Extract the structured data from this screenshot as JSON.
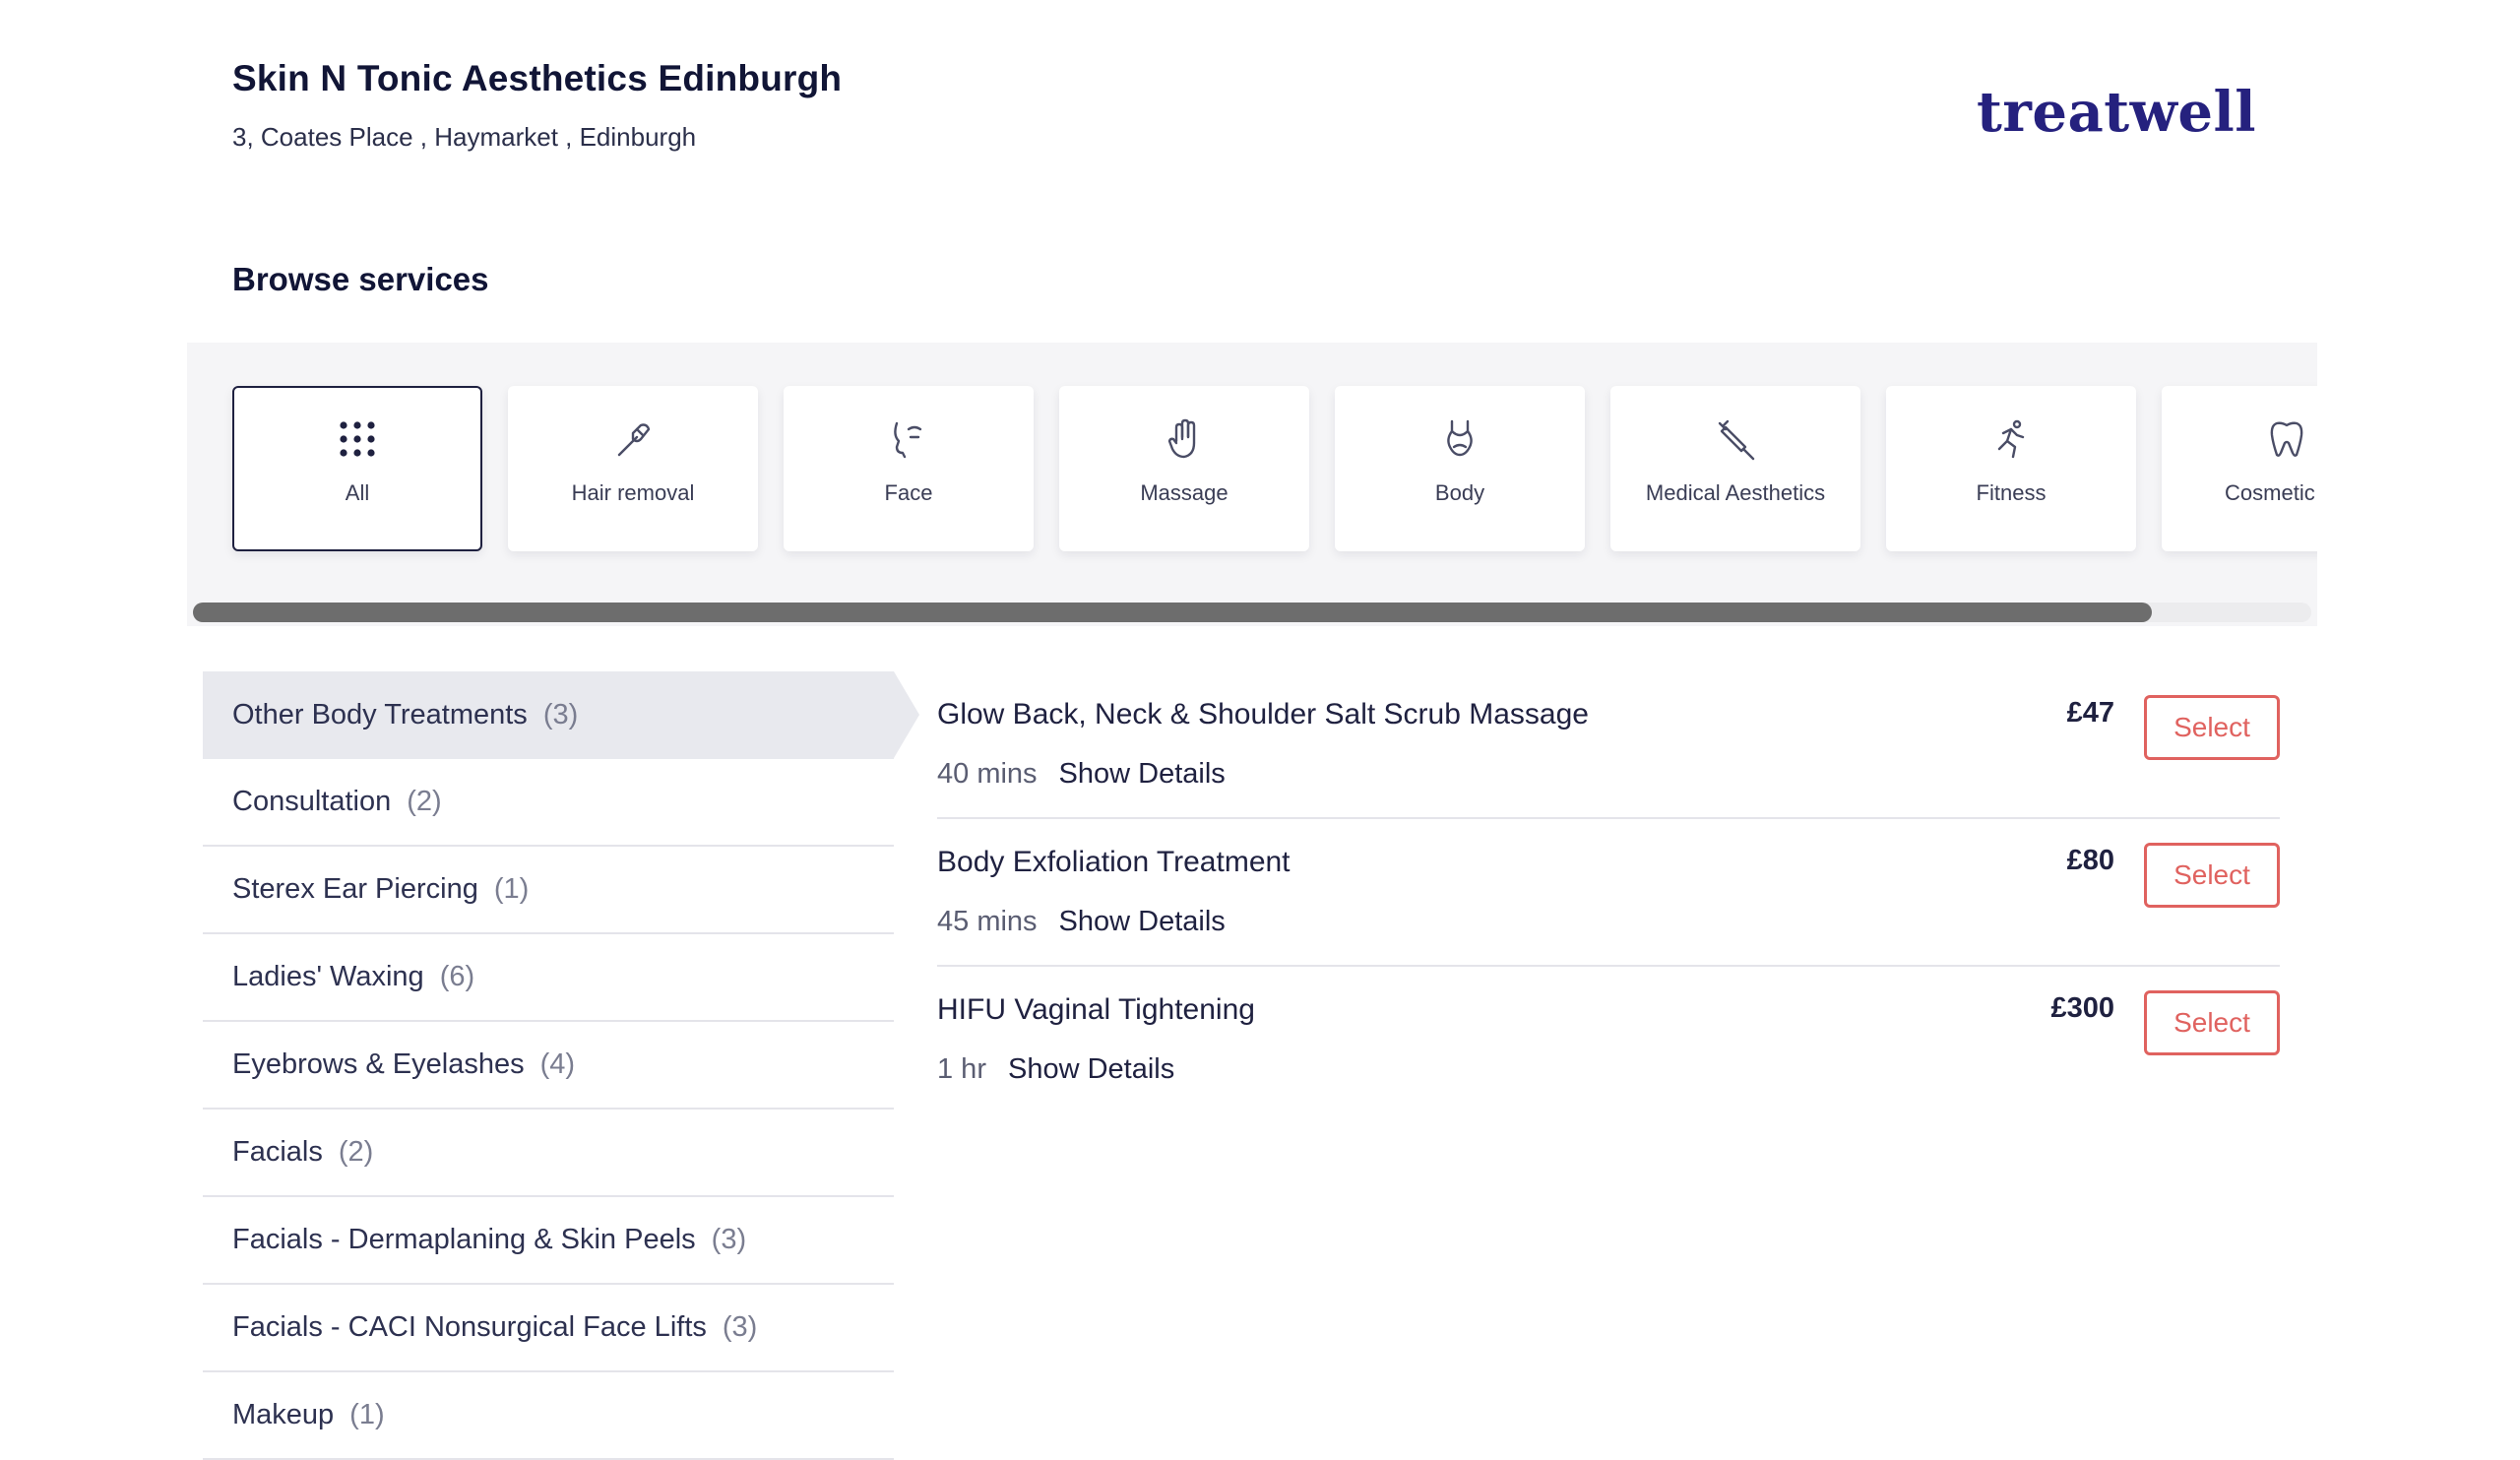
{
  "venue": {
    "title": "Skin N Tonic Aesthetics Edinburgh",
    "address": "3, Coates Place , Haymarket , Edinburgh"
  },
  "brand": {
    "logo_text": "treatwell",
    "color": "#25217e"
  },
  "browse": {
    "title": "Browse services"
  },
  "categories": [
    {
      "label": "All",
      "icon": "grid-dots-icon",
      "selected": true
    },
    {
      "label": "Hair removal",
      "icon": "razor-icon"
    },
    {
      "label": "Face",
      "icon": "face-profile-icon"
    },
    {
      "label": "Massage",
      "icon": "hand-icon"
    },
    {
      "label": "Body",
      "icon": "swimsuit-icon"
    },
    {
      "label": "Medical Aesthetics",
      "icon": "syringe-icon"
    },
    {
      "label": "Fitness",
      "icon": "running-person-icon"
    },
    {
      "label": "Cosmetic De",
      "icon": "tooth-icon"
    }
  ],
  "menu": [
    {
      "label": "Other Body Treatments",
      "count": "(3)",
      "selected": true
    },
    {
      "label": "Consultation",
      "count": "(2)"
    },
    {
      "label": "Sterex Ear Piercing",
      "count": "(1)"
    },
    {
      "label": "Ladies' Waxing",
      "count": "(6)"
    },
    {
      "label": "Eyebrows & Eyelashes",
      "count": "(4)"
    },
    {
      "label": "Facials",
      "count": "(2)"
    },
    {
      "label": "Facials - Dermaplaning & Skin Peels",
      "count": "(3)"
    },
    {
      "label": "Facials - CACI Nonsurgical Face Lifts",
      "count": "(3)"
    },
    {
      "label": "Makeup",
      "count": "(1)"
    }
  ],
  "services": [
    {
      "name": "Glow Back, Neck & Shoulder Salt Scrub Massage",
      "duration": "40 mins",
      "details": "Show Details",
      "price": "£47",
      "select": "Select"
    },
    {
      "name": "Body Exfoliation Treatment",
      "duration": "45 mins",
      "details": "Show Details",
      "price": "£80",
      "select": "Select"
    },
    {
      "name": "HIFU Vaginal Tightening",
      "duration": "1 hr",
      "details": "Show Details",
      "price": "£300",
      "select": "Select"
    }
  ],
  "colors": {
    "accent": "#e0625f",
    "text": "#1f2140"
  }
}
